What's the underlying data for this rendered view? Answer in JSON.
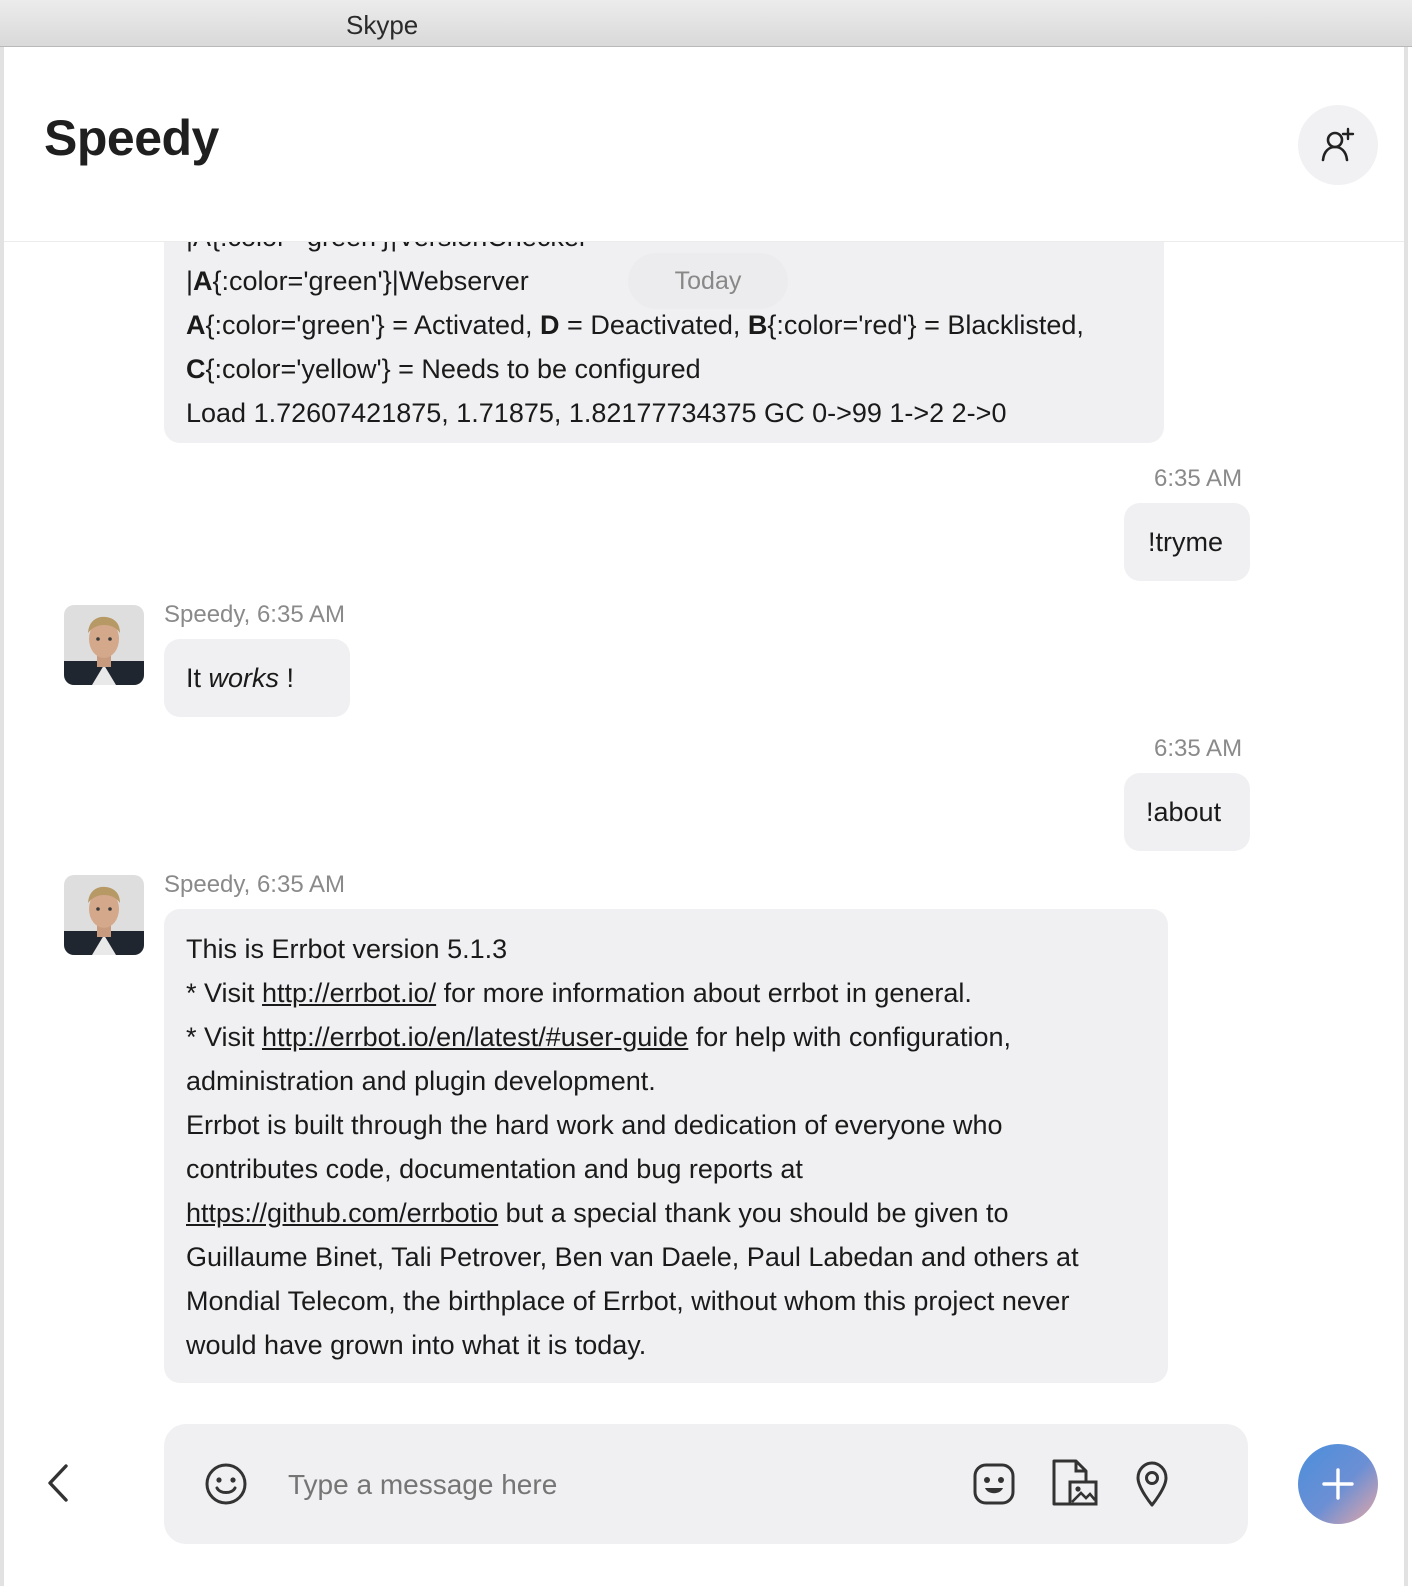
{
  "window": {
    "title": "Skype"
  },
  "header": {
    "chat_title": "Speedy",
    "add_person_icon": "add-person-icon"
  },
  "date_separator": "Today",
  "messages": {
    "status_bubble": {
      "partial_top": "|A{:color='green'}|VersionChecker",
      "line1_prefix": "|",
      "line1_bold": "A",
      "line1_rest": "{:color='green'}|Webserver",
      "legend_a_bold": "A",
      "legend_a": "{:color='green'} = Activated, ",
      "legend_d_bold": "D",
      "legend_d": " = Deactivated, ",
      "legend_b_bold": "B",
      "legend_b": "{:color='red'} = Blacklisted,",
      "legend_c_bold": "C",
      "legend_c": "{:color='yellow'} = Needs to be configured",
      "load_line": "Load 1.72607421875, 1.71875, 1.82177734375 GC 0->99 1->2 2->0"
    },
    "outgoing_1": {
      "time": "6:35 AM",
      "text": "!tryme"
    },
    "incoming_1": {
      "sender_time": "Speedy, 6:35 AM",
      "text_prefix": "It ",
      "text_italic": "works",
      "text_suffix": " !"
    },
    "outgoing_2": {
      "time": "6:35 AM",
      "text": "!about"
    },
    "incoming_2": {
      "sender_time": "Speedy, 6:35 AM",
      "l1": "This is Errbot version 5.1.3",
      "l2_pre": "* Visit ",
      "l2_link": "http://errbot.io/",
      "l2_post": " for more information about errbot in general.",
      "l3_pre": "* Visit ",
      "l3_link": "http://errbot.io/en/latest/#user-guide",
      "l3_post": " for help with configuration,",
      "l4": "administration and plugin development.",
      "l5": "Errbot is built through the hard work and dedication of everyone who",
      "l6": "contributes code, documentation and bug reports at",
      "l7_link": "https://github.com/errbotio",
      "l7_post": " but a special thank you should be given to",
      "l8": "Guillaume Binet, Tali Petrover, Ben van Daele, Paul Labedan and others at",
      "l9": "Mondial Telecom, the birthplace of Errbot, without whom this project never",
      "l10": "would have grown into what it is today."
    }
  },
  "composer": {
    "placeholder": "Type a message here",
    "icons": [
      "back-chevron-icon",
      "emoji-icon",
      "sticker-icon",
      "media-icon",
      "location-icon",
      "plus-icon"
    ]
  },
  "colors": {
    "bubble": "#f0f0f2",
    "accent_start": "#4a8fdc",
    "accent_end": "#e7a7a6",
    "meta_text": "#8a8a8a"
  }
}
